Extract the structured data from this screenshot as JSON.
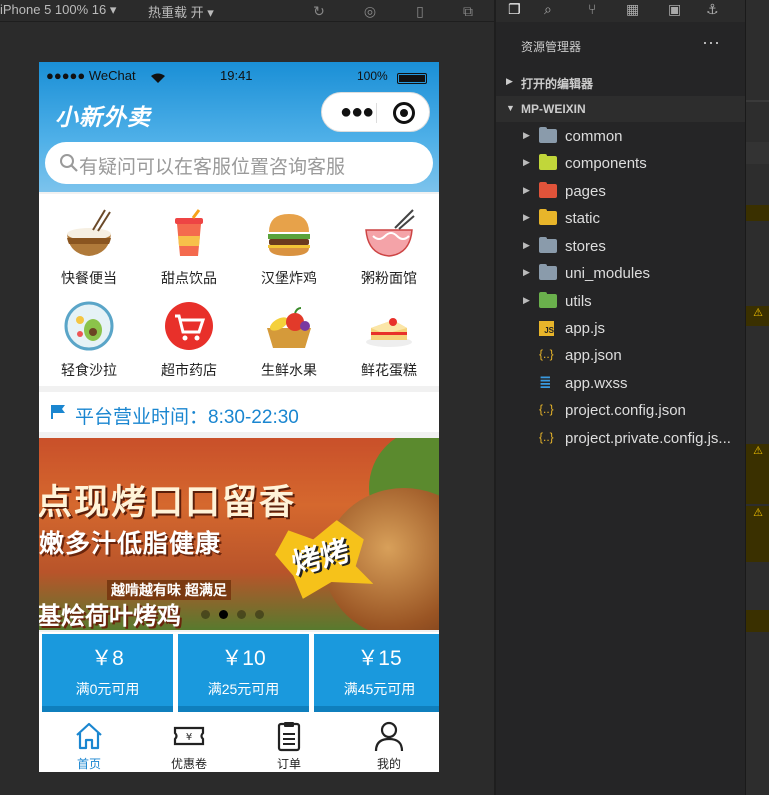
{
  "toolbar": {
    "device": "iPhone 5 100% 16 ▾",
    "hot_reload": "热重载 开 ▾"
  },
  "phone": {
    "status": {
      "carrier": "●●●●● WeChat",
      "time": "19:41",
      "battery": "100%"
    },
    "app_title": "小新外卖",
    "search_placeholder": "有疑问可以在客服位置咨询客服",
    "categories": [
      {
        "label": "快餐便当",
        "icon": "rice-bowl-icon"
      },
      {
        "label": "甜点饮品",
        "icon": "drink-cup-icon"
      },
      {
        "label": "汉堡炸鸡",
        "icon": "burger-icon"
      },
      {
        "label": "粥粉面馆",
        "icon": "noodle-bowl-icon"
      },
      {
        "label": "轻食沙拉",
        "icon": "salad-icon"
      },
      {
        "label": "超市药店",
        "icon": "shopping-cart-icon"
      },
      {
        "label": "生鲜水果",
        "icon": "fruit-basket-icon"
      },
      {
        "label": "鲜花蛋糕",
        "icon": "cake-icon"
      }
    ],
    "hours": "平台营业时间：8:30-22:30",
    "banner": {
      "line1": "点现烤口口留香",
      "line2": "嫩多汁低脂健康",
      "badge": "烤烤",
      "tagline": "越啃越有味 超满足",
      "line3": "基烩荷叶烤鸡",
      "dots": 4,
      "active_dot": 1
    },
    "coupons": [
      {
        "amount": "￥8",
        "condition": "满0元可用"
      },
      {
        "amount": "￥10",
        "condition": "满25元可用"
      },
      {
        "amount": "￥15",
        "condition": "满45元可用"
      }
    ],
    "tabs": [
      {
        "label": "首页",
        "icon": "home-icon",
        "active": true
      },
      {
        "label": "优惠卷",
        "icon": "coupon-ticket-icon",
        "active": false
      },
      {
        "label": "订单",
        "icon": "clipboard-icon",
        "active": false
      },
      {
        "label": "我的",
        "icon": "user-icon",
        "active": false
      }
    ]
  },
  "explorer": {
    "title": "资源管理器",
    "open_editors": "打开的编辑器",
    "project": "MP-WEIXIN",
    "items": [
      {
        "name": "common",
        "type": "folder",
        "color": "#8a9bab"
      },
      {
        "name": "components",
        "type": "folder",
        "color": "#c1d63a"
      },
      {
        "name": "pages",
        "type": "folder",
        "color": "#e0533a"
      },
      {
        "name": "static",
        "type": "folder",
        "color": "#e8b52a"
      },
      {
        "name": "stores",
        "type": "folder",
        "color": "#8a9bab"
      },
      {
        "name": "uni_modules",
        "type": "folder",
        "color": "#8a9bab"
      },
      {
        "name": "utils",
        "type": "folder",
        "color": "#6ab04c"
      },
      {
        "name": "app.js",
        "type": "js"
      },
      {
        "name": "app.json",
        "type": "json"
      },
      {
        "name": "app.wxss",
        "type": "css"
      },
      {
        "name": "project.config.json",
        "type": "json"
      },
      {
        "name": "project.private.config.js...",
        "type": "json"
      }
    ]
  },
  "colors": {
    "accent": "#1a99dd",
    "header_top": "#1a8fd6",
    "panel": "#252526"
  }
}
